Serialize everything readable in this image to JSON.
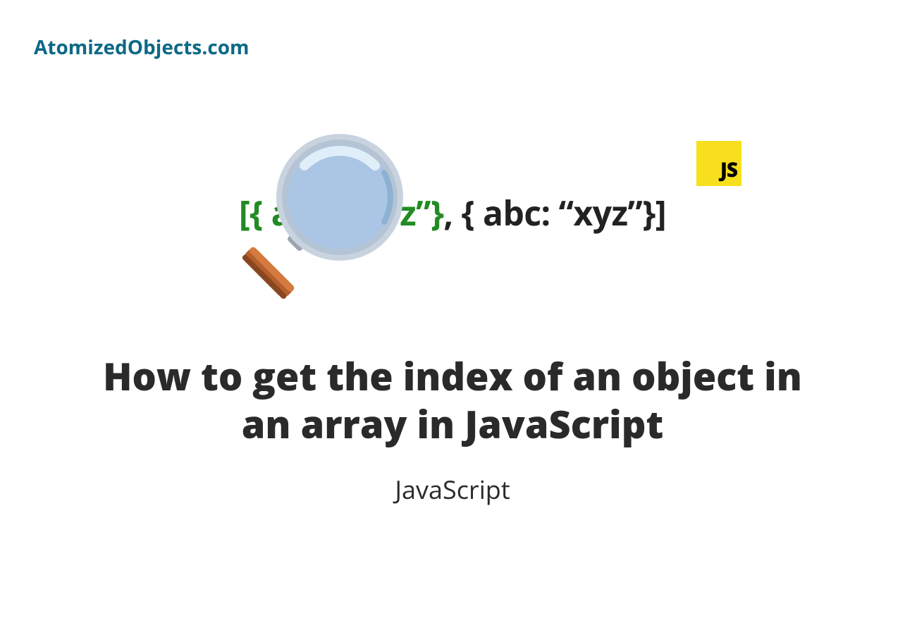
{
  "site_name": "AtomizedObjects.com",
  "hero": {
    "code_bracket_left": "[",
    "code_obj_green": "{ abc: “xyz”}",
    "code_comma": ", ",
    "code_obj_black": "{ abc: “xyz”}",
    "code_bracket_right": "]",
    "js_badge": "JS"
  },
  "title": "How to get the index of an object in an array in JavaScript",
  "category": "JavaScript",
  "colors": {
    "brand": "#0d6986",
    "js_yellow": "#f7df1e",
    "code_highlight": "#228B22",
    "text": "#2a2a2a"
  }
}
